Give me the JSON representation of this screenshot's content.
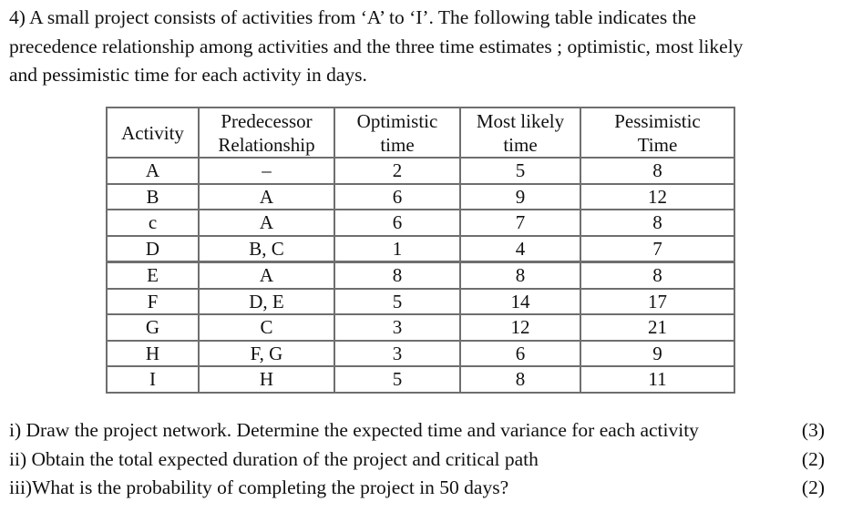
{
  "intro": {
    "lines": [
      "4) A small project consists of activities from ‘A’ to ‘I’. The following table indicates the",
      "precedence relationship among activities and the three time estimates ; optimistic, most likely",
      "and pessimistic time for each activity in days."
    ]
  },
  "table": {
    "headers": [
      [
        "Activity",
        ""
      ],
      [
        "Predecessor",
        "Relationship"
      ],
      [
        "Optimistic",
        "time"
      ],
      [
        "Most likely",
        "time"
      ],
      [
        "Pessimistic",
        "Time"
      ]
    ],
    "rows": [
      [
        "A",
        "–",
        "2",
        "5",
        "8"
      ],
      [
        "B",
        "A",
        "6",
        "9",
        "12"
      ],
      [
        "c",
        "A",
        "6",
        "7",
        "8"
      ],
      [
        "D",
        "B, C",
        "1",
        "4",
        "7"
      ],
      [
        "E",
        "A",
        "8",
        "8",
        "8"
      ],
      [
        "F",
        "D,  E",
        "5",
        "14",
        "17"
      ],
      [
        "G",
        "C",
        "3",
        "12",
        "21"
      ],
      [
        "H",
        "F, G",
        "3",
        "6",
        "9"
      ],
      [
        "I",
        "H",
        "5",
        "8",
        "11"
      ]
    ]
  },
  "questions": [
    {
      "text": "i)  Draw the project network. Determine the expected time and variance for each activity",
      "marks": "(3)"
    },
    {
      "text": "ii) Obtain the total expected duration of the project and critical path",
      "marks": "(2)"
    },
    {
      "text": "iii)What is the probability of completing the project in 50 days?",
      "marks": "(2)"
    }
  ]
}
